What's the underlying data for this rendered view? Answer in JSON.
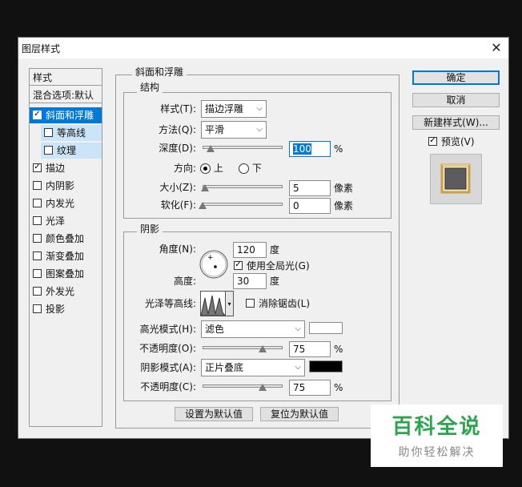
{
  "window": {
    "title": "图层样式",
    "close": "✕"
  },
  "sidebar": {
    "header": "样式",
    "blend_options": "混合选项:默认",
    "items": [
      {
        "label": "斜面和浮雕",
        "checked": true,
        "selected": true
      },
      {
        "label": "等高线",
        "checked": false,
        "sub": true
      },
      {
        "label": "纹理",
        "checked": false,
        "sub": true
      },
      {
        "label": "描边",
        "checked": true
      },
      {
        "label": "内阴影",
        "checked": false
      },
      {
        "label": "内发光",
        "checked": false
      },
      {
        "label": "光泽",
        "checked": false
      },
      {
        "label": "颜色叠加",
        "checked": false
      },
      {
        "label": "渐变叠加",
        "checked": false
      },
      {
        "label": "图案叠加",
        "checked": false
      },
      {
        "label": "外发光",
        "checked": false
      },
      {
        "label": "投影",
        "checked": false
      }
    ]
  },
  "bevel": {
    "group_title": "斜面和浮雕",
    "structure": {
      "title": "结构",
      "style_label": "样式(T):",
      "style_value": "描边浮雕",
      "technique_label": "方法(Q):",
      "technique_value": "平滑",
      "depth_label": "深度(D):",
      "depth_value": "100",
      "depth_unit": "%",
      "depth_slider": 0.1,
      "direction_label": "方向:",
      "dir_up": "上",
      "dir_down": "下",
      "size_label": "大小(Z):",
      "size_value": "5",
      "size_unit": "像素",
      "size_slider": 0.03,
      "soften_label": "软化(F):",
      "soften_value": "0",
      "soften_unit": "像素",
      "soften_slider": 0.0
    },
    "shading": {
      "title": "阴影",
      "angle_label": "角度(N):",
      "angle_value": "120",
      "angle_unit": "度",
      "global_light": "使用全局光(G)",
      "altitude_label": "高度:",
      "altitude_value": "30",
      "altitude_unit": "度",
      "gloss_label": "光泽等高线:",
      "antialias": "消除锯齿(L)",
      "highlight_mode_label": "高光模式(H):",
      "highlight_mode_value": "滤色",
      "highlight_color": "#ffffff",
      "highlight_opacity_label": "不透明度(O):",
      "highlight_opacity_value": "75",
      "highlight_opacity_unit": "%",
      "highlight_opacity_slider": 0.75,
      "shadow_mode_label": "阴影模式(A):",
      "shadow_mode_value": "正片叠底",
      "shadow_color": "#000000",
      "shadow_opacity_label": "不透明度(C):",
      "shadow_opacity_value": "75",
      "shadow_opacity_unit": "%",
      "shadow_opacity_slider": 0.75
    },
    "make_default": "设置为默认值",
    "reset_default": "复位为默认值"
  },
  "actions": {
    "ok": "确定",
    "cancel": "取消",
    "new_style": "新建样式(W)...",
    "preview": "预览(V)"
  },
  "watermark": {
    "title": "百科全说",
    "subtitle": "助你轻松解决"
  },
  "colors": {
    "accent": "#0078d7",
    "watermark_green": "#2da44e",
    "sub_item_bg": "#cce4f7"
  }
}
